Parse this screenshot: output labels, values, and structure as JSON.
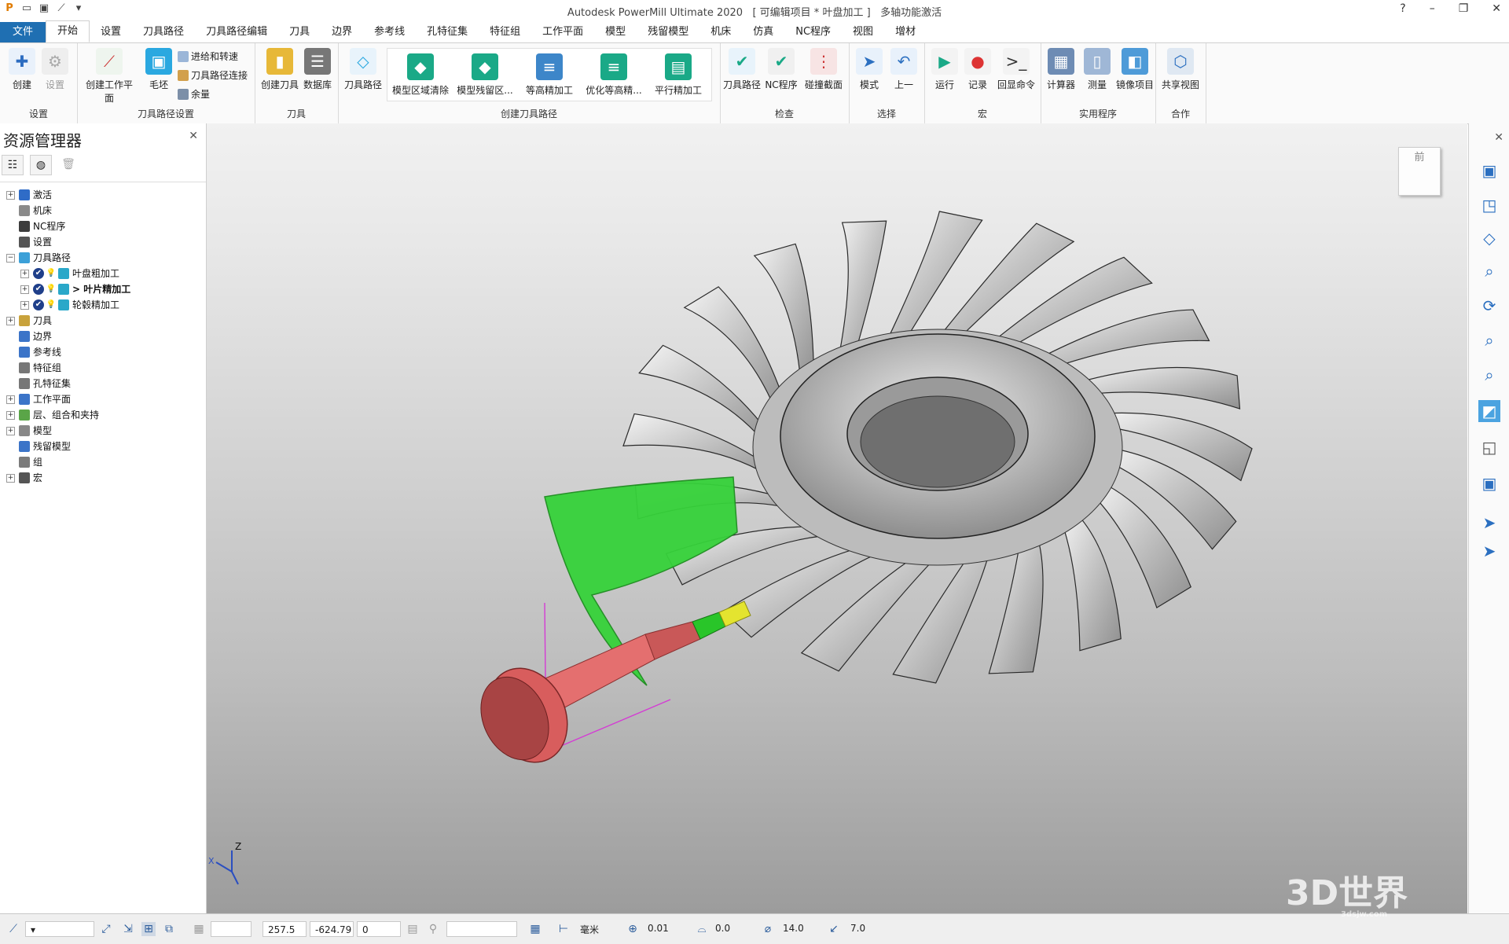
{
  "app": {
    "title": "Autodesk PowerMill Ultimate 2020",
    "project": "[ 可编辑项目 * 叶盘加工 ]",
    "license": "多轴功能激活"
  },
  "tabs": [
    "文件",
    "开始",
    "设置",
    "刀具路径",
    "刀具路径编辑",
    "刀具",
    "边界",
    "参考线",
    "孔特征集",
    "特征组",
    "工作平面",
    "模型",
    "残留模型",
    "机床",
    "仿真",
    "NC程序",
    "视图",
    "增材"
  ],
  "ribbon": {
    "groups": {
      "settings": "设置",
      "toolpath_setup": "刀具路径设置",
      "tool": "刀具",
      "create_toolpath": "创建刀具路径",
      "verify": "检查",
      "select": "选择",
      "macro": "宏",
      "utilities": "实用程序",
      "collab": "合作"
    },
    "buttons": {
      "create": "创建",
      "setup": "设置",
      "create_workplane": "创建工作平面",
      "block": "毛坯",
      "feeds_speeds": "进给和转速",
      "toolpath_connect": "刀具路径连接",
      "thickness": "余量",
      "create_tool": "创建刀具",
      "database": "数据库",
      "toolpath": "刀具路径",
      "model_area_clear": "模型区域清除",
      "model_rest": "模型残留区...",
      "constant_z": "等高精加工",
      "opt_constant_z": "优化等高精...",
      "raster": "平行精加工",
      "check_toolpath": "刀具路径",
      "check_nc": "NC程序",
      "collision_section": "碰撞截面",
      "mode": "模式",
      "previous": "上一",
      "run": "运行",
      "record": "记录",
      "echo_cmd": "回显命令",
      "calculator": "计算器",
      "measure": "测量",
      "mirror": "镜像项目",
      "share_view": "共享视图"
    }
  },
  "explorer": {
    "title": "资源管理器",
    "tree": [
      {
        "label": "激活",
        "color": "#2f6cc7"
      },
      {
        "label": "机床",
        "color": "#8a8a8a"
      },
      {
        "label": "NC程序",
        "color": "#3c3c3c"
      },
      {
        "label": "设置",
        "color": "#555555"
      },
      {
        "label": "刀具路径",
        "color": "#3ca0d8"
      },
      {
        "label": "叶盘粗加工",
        "color": "#2aa8c9"
      },
      {
        "label": "> 叶片精加工",
        "color": "#2aa8c9"
      },
      {
        "label": "轮毂精加工",
        "color": "#2aa8c9"
      },
      {
        "label": "刀具",
        "color": "#c8a23c"
      },
      {
        "label": "边界",
        "color": "#3b74c8"
      },
      {
        "label": "参考线",
        "color": "#3b74c8"
      },
      {
        "label": "特征组",
        "color": "#777777"
      },
      {
        "label": "孔特征集",
        "color": "#777777"
      },
      {
        "label": "工作平面",
        "color": "#3b74c8"
      },
      {
        "label": "层、组合和夹持",
        "color": "#5aa548"
      },
      {
        "label": "模型",
        "color": "#888888"
      },
      {
        "label": "残留模型",
        "color": "#3b74c8"
      },
      {
        "label": "组",
        "color": "#7b7b7b"
      },
      {
        "label": "宏",
        "color": "#555555"
      }
    ]
  },
  "viewcube": {
    "label": "前"
  },
  "status": {
    "x": "257.5",
    "y": "-624.79",
    "z": "0",
    "units": "毫米",
    "tolerance": "0.01",
    "thickness": "0.0",
    "diameter": "14.0",
    "stepover": "7.0"
  },
  "watermark": {
    "text": "3D世界",
    "url": "3dsjw.com"
  }
}
